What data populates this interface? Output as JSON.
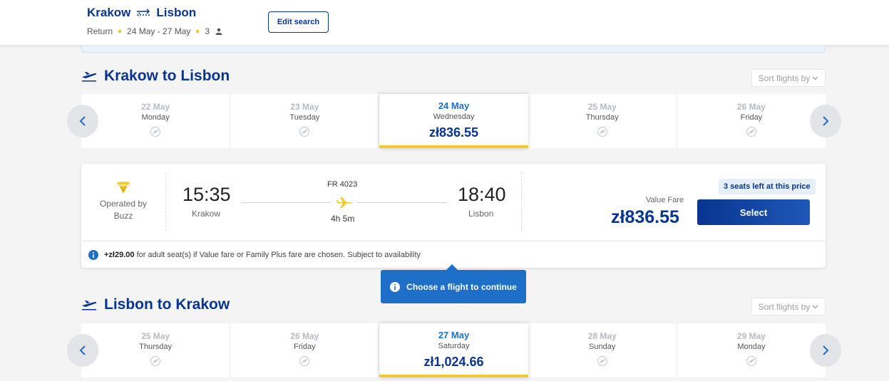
{
  "header": {
    "origin": "Krakow",
    "destination": "Lisbon",
    "trip_type": "Return",
    "dates": "24 May - 27 May",
    "passengers": "3",
    "edit_button": "Edit search"
  },
  "outbound": {
    "title": "Krakow to Lisbon",
    "sort_label": "Sort flights by",
    "days": [
      {
        "date": "22 May",
        "weekday": "Monday"
      },
      {
        "date": "23 May",
        "weekday": "Tuesday"
      },
      {
        "date": "24 May",
        "weekday": "Wednesday",
        "price": "zł836.55"
      },
      {
        "date": "25 May",
        "weekday": "Thursday"
      },
      {
        "date": "26 May",
        "weekday": "Friday"
      }
    ]
  },
  "flight": {
    "operator_label": "Operated by",
    "operator_name": "Buzz",
    "departure_time": "15:35",
    "departure_city": "Krakow",
    "flight_number": "FR 4023",
    "duration": "4h 5m",
    "arrival_time": "18:40",
    "arrival_city": "Lisbon",
    "seats_badge": "3 seats left at this price",
    "fare_label": "Value Fare",
    "fare_price": "zł836.55",
    "select_button": "Select",
    "notice_amount": "+zł29.00",
    "notice_text": "for adult seat(s) if Value fare or Family Plus fare are chosen. Subject to availability"
  },
  "tooltip": {
    "text": "Choose a flight to continue"
  },
  "return": {
    "title": "Lisbon to Krakow",
    "sort_label": "Sort flights by",
    "days": [
      {
        "date": "25 May",
        "weekday": "Thursday"
      },
      {
        "date": "26 May",
        "weekday": "Friday"
      },
      {
        "date": "27 May",
        "weekday": "Saturday",
        "price": "zł1,024.66"
      },
      {
        "date": "28 May",
        "weekday": "Sunday"
      },
      {
        "date": "29 May",
        "weekday": "Monday"
      }
    ]
  },
  "colors": {
    "brand_blue": "#073590",
    "accent_yellow": "#f1c933",
    "info_blue": "#1e6fc8"
  }
}
